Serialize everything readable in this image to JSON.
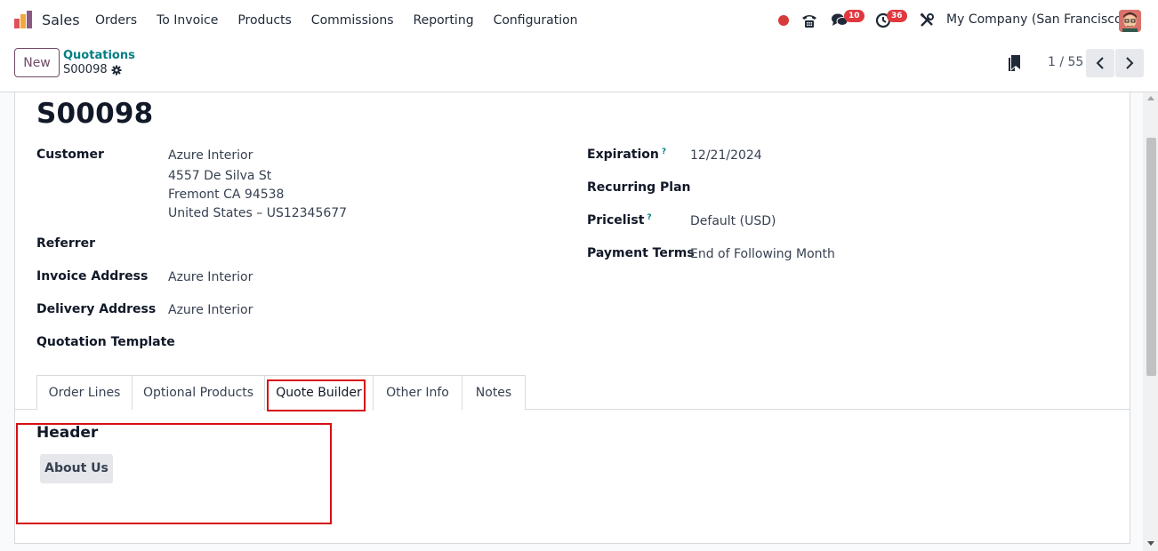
{
  "navbar": {
    "app_name": "Sales",
    "menu": [
      "Orders",
      "To Invoice",
      "Products",
      "Commissions",
      "Reporting",
      "Configuration"
    ],
    "messages_badge": "10",
    "activities_badge": "36",
    "company": "My Company (San Francisco)"
  },
  "control_panel": {
    "new_label": "New",
    "breadcrumb_parent": "Quotations",
    "breadcrumb_current": "S00098",
    "pager_value": "1 / 55"
  },
  "form": {
    "title": "S00098",
    "left": {
      "customer_label": "Customer",
      "customer_name": "Azure Interior",
      "customer_address": [
        "4557 De Silva St",
        "Fremont CA 94538",
        "United States – US12345677"
      ],
      "referrer_label": "Referrer",
      "invoice_address_label": "Invoice Address",
      "invoice_address_value": "Azure Interior",
      "delivery_address_label": "Delivery Address",
      "delivery_address_value": "Azure Interior",
      "quotation_template_label": "Quotation Template"
    },
    "right": {
      "expiration_label": "Expiration",
      "expiration_value": "12/21/2024",
      "recurring_plan_label": "Recurring Plan",
      "pricelist_label": "Pricelist",
      "pricelist_value": "Default (USD)",
      "payment_terms_label": "Payment Terms",
      "payment_terms_value": "End of Following Month",
      "help_mark": "?"
    }
  },
  "tabs": [
    "Order Lines",
    "Optional Products",
    "Quote Builder",
    "Other Info",
    "Notes"
  ],
  "active_tab": "Quote Builder",
  "quote_builder": {
    "section_title": "Header",
    "button_label": "About Us"
  },
  "colors": {
    "brand": "#714b67",
    "link": "#017e84",
    "badge": "#e0383e",
    "highlight": "#d50f14"
  }
}
